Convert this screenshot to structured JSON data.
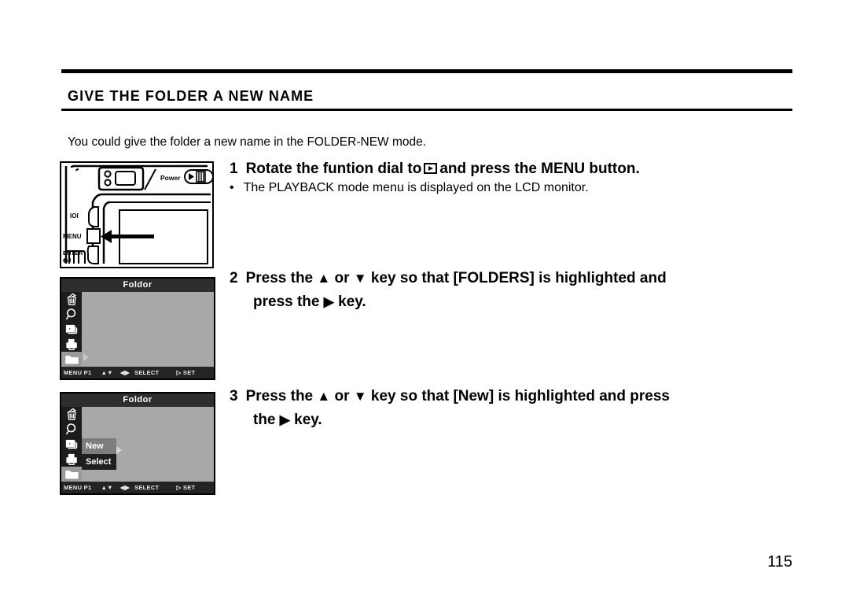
{
  "document": {
    "heading": "GIVE THE FOLDER A NEW NAME",
    "intro": "You could give the folder a new name in the FOLDER-NEW mode.",
    "page_number": "115"
  },
  "steps": [
    {
      "number": "1",
      "text_before_icon": "Rotate the funtion dial to",
      "icon": "playback-icon",
      "text_after_icon": "and press the MENU button.",
      "bullet": {
        "marker": "•",
        "text": "The PLAYBACK mode menu is displayed on the LCD monitor."
      }
    },
    {
      "number": "2",
      "line1_a": "Press the",
      "up_key": "▲",
      "line1_b": "or",
      "down_key": "▼",
      "line1_c": "key so that [FOLDERS] is highlighted and",
      "line2_a": "press the",
      "right_key": "▶",
      "line2_b": "key."
    },
    {
      "number": "3",
      "line1_a": "Press the",
      "up_key": "▲",
      "line1_b": "or",
      "down_key": "▼",
      "line1_c": "key so that [New] is highlighted and press",
      "line2_a": "the",
      "right_key": "▶",
      "line2_b": "key."
    }
  ],
  "camera_figure": {
    "power_label": "Power",
    "display_button_label": "IOI",
    "menu_button_label": "MENU",
    "enter_button_label": "ENTER",
    "enter_sub_label": "⊙/⌷"
  },
  "lcd_screens": [
    {
      "title": "Foldor",
      "icons": [
        "trash-icon",
        "magnifier-icon",
        "slideshow-icon",
        "printer-icon",
        "folder-icon"
      ],
      "selected_icon": "folder-icon",
      "submenu": [],
      "status": {
        "menu": "MENU P1",
        "updown": "▲▼",
        "leftright": "◀▶",
        "select": "SELECT",
        "set": "▷ SET"
      }
    },
    {
      "title": "Foldor",
      "icons": [
        "trash-icon",
        "magnifier-icon",
        "slideshow-icon",
        "printer-icon",
        "folder-icon"
      ],
      "selected_icon": "folder-icon",
      "submenu": [
        {
          "label": "New",
          "highlighted": true
        },
        {
          "label": "Select",
          "highlighted": false
        }
      ],
      "status": {
        "menu": "MENU P1",
        "updown": "▲▼",
        "leftright": "◀▶",
        "select": "SELECT",
        "set": "▷ SET"
      }
    }
  ]
}
